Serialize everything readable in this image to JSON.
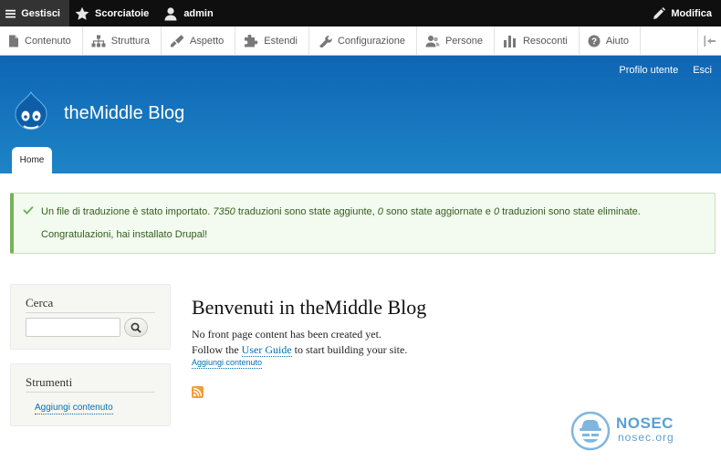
{
  "toolbar": {
    "manage_label": "Gestisci",
    "shortcuts_label": "Scorciatoie",
    "user_label": "admin",
    "edit_label": "Modifica"
  },
  "tray": {
    "items": [
      {
        "label": "Contenuto",
        "icon": "file-icon"
      },
      {
        "label": "Struttura",
        "icon": "sitemap-icon"
      },
      {
        "label": "Aspetto",
        "icon": "paintbrush-icon"
      },
      {
        "label": "Estendi",
        "icon": "puzzle-icon"
      },
      {
        "label": "Configurazione",
        "icon": "wrench-icon"
      },
      {
        "label": "Persone",
        "icon": "people-icon"
      },
      {
        "label": "Resoconti",
        "icon": "bar-chart-icon"
      },
      {
        "label": "Aiuto",
        "icon": "help-icon"
      }
    ]
  },
  "header": {
    "site_name": "theMiddle Blog",
    "secondary_menu": [
      "Profilo utente",
      "Esci"
    ],
    "main_tab": "Home"
  },
  "messages": {
    "line1_a": "Un file di traduzione è stato importato. ",
    "line1_n1": "7350",
    "line1_b": " traduzioni sono state aggiunte, ",
    "line1_n2": "0",
    "line1_c": " sono state aggiornate e ",
    "line1_n3": "0",
    "line1_d": " traduzioni sono state eliminate.",
    "line2": "Congratulazioni, hai installato Drupal!"
  },
  "sidebar": {
    "search_title": "Cerca",
    "search_value": "",
    "tools_title": "Strumenti",
    "tools_link": "Aggiungi contenuto"
  },
  "content": {
    "title": "Benvenuti in theMiddle Blog",
    "p1": "No front page content has been created yet.",
    "p2_a": "Follow the ",
    "p2_link": "User Guide",
    "p2_b": " to start building your site.",
    "add_link": "Aggiungi contenuto"
  },
  "watermark": {
    "name": "NOSEC",
    "domain": "nosec.org"
  },
  "colors": {
    "toolbar_bg": "#0f0f0f",
    "header_top": "#0f65b4",
    "header_bottom": "#1d84c6",
    "link": "#0071b3",
    "success_text": "#325e1c",
    "success_border": "#77b259"
  }
}
